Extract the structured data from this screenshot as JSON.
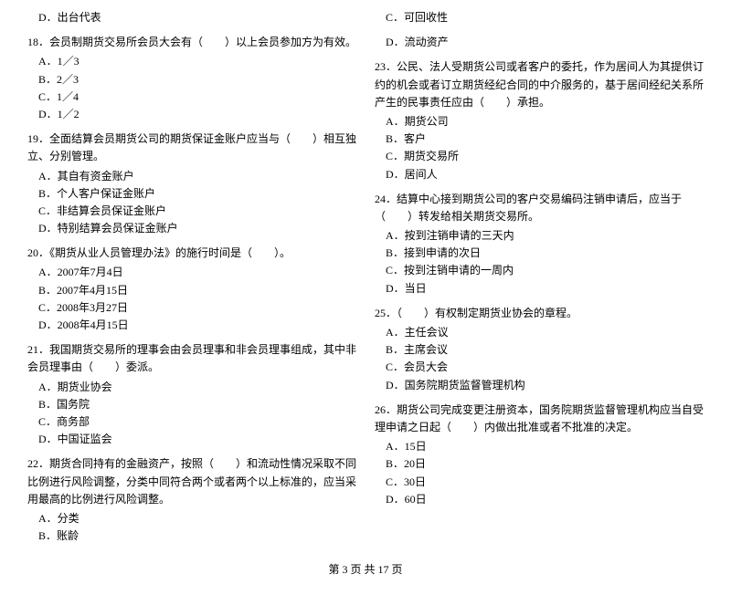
{
  "left_column": [
    {
      "id": "q_d_top",
      "title": "D．出台代表",
      "options": []
    },
    {
      "id": "q18",
      "title": "18．会员制期货交易所会员大会有（　　）以上会员参加方为有效。",
      "options": [
        "A．1／3",
        "B．2／3",
        "C．1／4",
        "D．1／2"
      ]
    },
    {
      "id": "q19",
      "title": "19．全面结算会员期货公司的期货保证金账户应当与（　　）相互独立、分别管理。",
      "options": [
        "A．其自有资金账户",
        "B．个人客户保证金账户",
        "C．非结算会员保证金账户",
        "D．特别结算会员保证金账户"
      ]
    },
    {
      "id": "q20",
      "title": "20．《期货从业人员管理办法》的施行时间是（　　）。",
      "options": [
        "A．2007年7月4日",
        "B．2007年4月15日",
        "C．2008年3月27日",
        "D．2008年4月15日"
      ]
    },
    {
      "id": "q21",
      "title": "21．我国期货交易所的理事会由会员理事和非会员理事组成，其中非会员理事由（　　）委派。",
      "options": [
        "A．期货业协会",
        "B．国务院",
        "C．商务部",
        "D．中国证监会"
      ]
    },
    {
      "id": "q22",
      "title": "22．期货合同持有的金融资产，按照（　　）和流动性情况采取不同比例进行风险调整，分类中同符合两个或者两个以上标准的，应当采用最高的比例进行风险调整。",
      "options": [
        "A．分类",
        "B．账龄"
      ]
    }
  ],
  "right_column": [
    {
      "id": "q_c_top",
      "title": "C．可回收性",
      "options": []
    },
    {
      "id": "q_d_top2",
      "title": "D．流动资产",
      "options": []
    },
    {
      "id": "q23",
      "title": "23．公民、法人受期货公司或者客户的委托，作为居间人为其提供订约的机会或者订立期货经纪合同的中介服务的，基于居间经纪关系所产生的民事责任应由（　　）承担。",
      "options": [
        "A．期货公司",
        "B．客户",
        "C．期货交易所",
        "D．居间人"
      ]
    },
    {
      "id": "q24",
      "title": "24．结算中心接到期货公司的客户交易编码注销申请后，应当于（　　）转发给相关期货交易所。",
      "options": [
        "A．按到注销申请的三天内",
        "B．接到申请的次日",
        "C．按到注销申请的一周内",
        "D．当日"
      ]
    },
    {
      "id": "q25",
      "title": "25．（　　）有权制定期货业协会的章程。",
      "options": [
        "A．主任会议",
        "B．主席会议",
        "C．会员大会",
        "D．国务院期货监督管理机构"
      ]
    },
    {
      "id": "q26",
      "title": "26．期货公司完成变更注册资本，国务院期货监督管理机构应当自受理申请之日起（　　）内做出批准或者不批准的决定。",
      "options": [
        "A．15日",
        "B．20日",
        "C．30日",
        "D．60日"
      ]
    }
  ],
  "footer": {
    "page_info": "第 3 页 共 17 页"
  }
}
